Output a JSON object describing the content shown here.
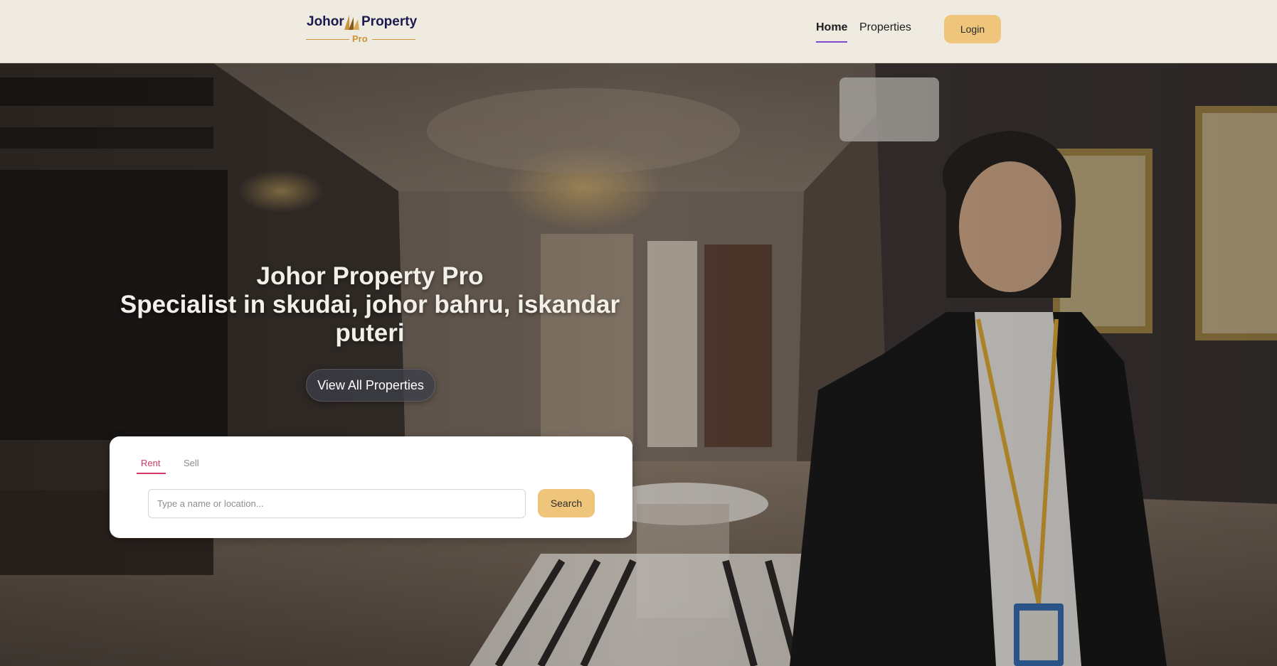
{
  "brand": {
    "name_left": "Johor",
    "name_right": "Property",
    "subtitle": "Pro"
  },
  "nav": {
    "items": [
      {
        "label": "Home",
        "active": true
      },
      {
        "label": "Properties",
        "active": false
      }
    ],
    "login_label": "Login"
  },
  "hero": {
    "title_line1": "Johor Property Pro",
    "title_line2": "Specialist in skudai, johor bahru, iskandar puteri",
    "cta_label": "View All Properties"
  },
  "search": {
    "tabs": [
      {
        "label": "Rent",
        "active": true
      },
      {
        "label": "Sell",
        "active": false
      }
    ],
    "input_value": "",
    "placeholder": "Type a name or location...",
    "button_label": "Search"
  },
  "colors": {
    "accent": "#efc57c",
    "nav_active": "#7d4ad6",
    "tab_active": "#d23c66",
    "brand": "#1c1a4e",
    "brand_gold": "#c9943a",
    "navbar_bg": "#efebe1"
  }
}
